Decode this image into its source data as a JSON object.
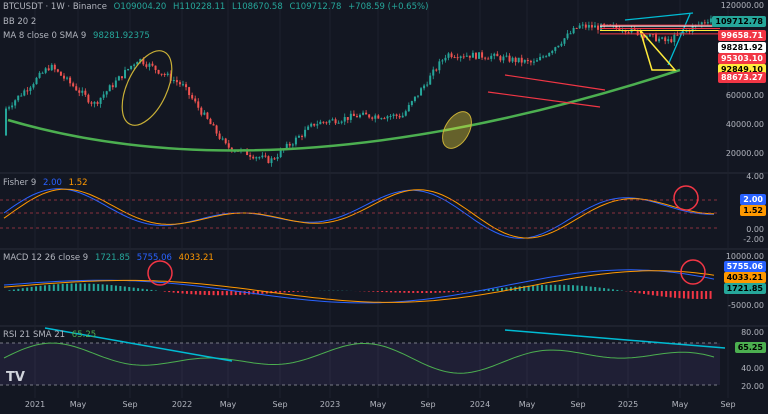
{
  "header": {
    "symbol": "BTCUSDT · 1W · Binance",
    "open": "O109004.20",
    "high": "H110228.11",
    "low": "L108670.58",
    "close": "C109712.78",
    "change": "+708.59 (+0.65%)",
    "bb": "BB 20 2",
    "ma": "MA 8 close 0 SMA 9",
    "ma_value": "98281.92375"
  },
  "fisher_header": {
    "name": "Fisher 9",
    "v1": "2.00",
    "v2": "1.52"
  },
  "macd_header": {
    "name": "MACD 12 26 close 9",
    "v1": "1721.85",
    "v2": "5755.06",
    "v3": "4033.21"
  },
  "rsi_header": {
    "name": "RSI 21 SMA 21",
    "v1": "65.25"
  },
  "price_labels": [
    {
      "text": "109712.78",
      "bg": "#26a69a",
      "fg": "#000000"
    },
    {
      "text": "99658.71",
      "bg": "#f23645",
      "fg": "#ffffff"
    },
    {
      "text": "98281.92",
      "bg": "#ffffff",
      "fg": "#000000"
    },
    {
      "text": "95303.10",
      "bg": "#f23645",
      "fg": "#ffffff"
    },
    {
      "text": "92849.10",
      "bg": "#ffeb3b",
      "fg": "#000000"
    },
    {
      "text": "88673.27",
      "bg": "#f23645",
      "fg": "#ffffff"
    }
  ],
  "fisher_labels": [
    {
      "text": "2.00",
      "bg": "#2962ff",
      "fg": "#ffffff"
    },
    {
      "text": "1.52",
      "bg": "#ff9800",
      "fg": "#000000"
    }
  ],
  "macd_labels": [
    {
      "text": "5755.06",
      "bg": "#2962ff",
      "fg": "#ffffff"
    },
    {
      "text": "4033.21",
      "bg": "#ff9800",
      "fg": "#000000"
    },
    {
      "text": "1721.85",
      "bg": "#26a69a",
      "fg": "#000000"
    }
  ],
  "rsi_labels": [
    {
      "text": "65.25",
      "bg": "#4caf50",
      "fg": "#000000"
    }
  ],
  "y_ticks_price": [
    "120000.00",
    "80000.00",
    "60000.00",
    "40000.00",
    "20000.00"
  ],
  "y_ticks_fisher": [
    "4.00",
    "2.00",
    "0.00",
    "-2.00"
  ],
  "y_ticks_macd": [
    "10000.00",
    "0.00",
    "-5000.00"
  ],
  "y_ticks_rsi": [
    "80.00",
    "60.00",
    "40.00",
    "20.00"
  ],
  "x_ticks": [
    "2021",
    "May",
    "Sep",
    "2022",
    "May",
    "Sep",
    "2023",
    "May",
    "Sep",
    "2024",
    "May",
    "Sep",
    "2025",
    "May",
    "Sep"
  ],
  "logo": "TV",
  "chart_data": {
    "type": "line",
    "title": "BTCUSDT · 1W · Binance",
    "price_scale": "log",
    "x": [
      "2021-01",
      "2021-04",
      "2021-07",
      "2021-11",
      "2022-03",
      "2022-06",
      "2022-11",
      "2023-03",
      "2023-07",
      "2023-10",
      "2024-03",
      "2024-06",
      "2024-09",
      "2024-12",
      "2025-02",
      "2025-04",
      "2025-05"
    ],
    "series": [
      {
        "name": "BTCUSDT",
        "values": [
          33000,
          58000,
          35000,
          64000,
          45000,
          20000,
          16500,
          27000,
          30000,
          30000,
          68000,
          66000,
          60000,
          98000,
          96000,
          80000,
          109712.78
        ]
      }
    ],
    "ylim": [
      15000,
      125000
    ],
    "levels": [
      {
        "value": 99658.71,
        "color": "#f23645"
      },
      {
        "value": 98281.92,
        "color": "#ffffff"
      },
      {
        "value": 95303.1,
        "color": "#f23645"
      },
      {
        "value": 92849.1,
        "color": "#ffeb3b"
      },
      {
        "value": 88673.27,
        "color": "#f23645"
      }
    ],
    "indicators": {
      "fisher": {
        "fisher": 2.0,
        "trigger": 1.52
      },
      "macd": {
        "macd": 5755.06,
        "signal": 4033.21,
        "histogram": 1721.85
      },
      "rsi": {
        "rsi": 65.25
      }
    }
  }
}
